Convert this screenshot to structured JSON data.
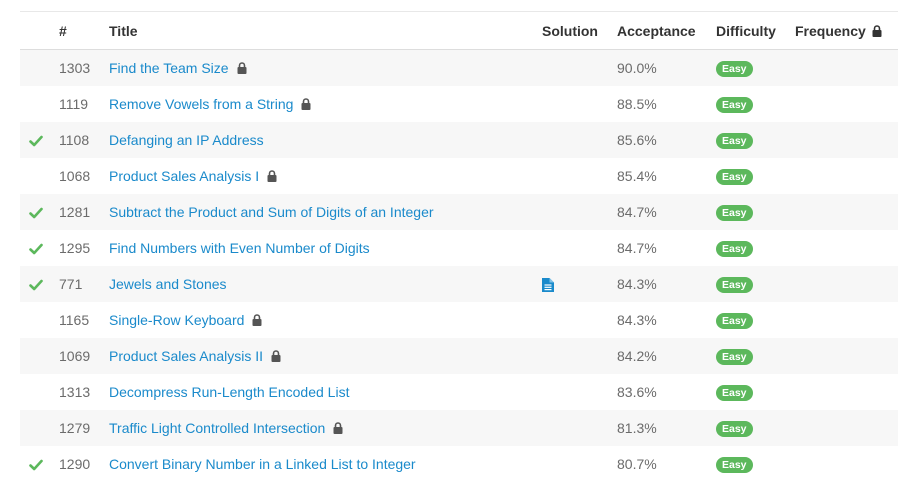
{
  "colors": {
    "link": "#1a8acb",
    "check": "#5cb85c",
    "easy_badge": "#5cb85c",
    "solution_icon": "#1a8acb",
    "lock": "#555555",
    "row_stripe": "#f7f7f7"
  },
  "columns": {
    "id": "#",
    "title": "Title",
    "solution": "Solution",
    "acceptance": "Acceptance",
    "difficulty": "Difficulty",
    "frequency": "Frequency"
  },
  "frequency_locked": true,
  "problems": [
    {
      "solved": false,
      "id": "1303",
      "title": "Find the Team Size",
      "locked": true,
      "solution": false,
      "acceptance": "90.0%",
      "difficulty": "Easy"
    },
    {
      "solved": false,
      "id": "1119",
      "title": "Remove Vowels from a String",
      "locked": true,
      "solution": false,
      "acceptance": "88.5%",
      "difficulty": "Easy"
    },
    {
      "solved": true,
      "id": "1108",
      "title": "Defanging an IP Address",
      "locked": false,
      "solution": false,
      "acceptance": "85.6%",
      "difficulty": "Easy"
    },
    {
      "solved": false,
      "id": "1068",
      "title": "Product Sales Analysis I",
      "locked": true,
      "solution": false,
      "acceptance": "85.4%",
      "difficulty": "Easy"
    },
    {
      "solved": true,
      "id": "1281",
      "title": "Subtract the Product and Sum of Digits of an Integer",
      "locked": false,
      "solution": false,
      "acceptance": "84.7%",
      "difficulty": "Easy"
    },
    {
      "solved": true,
      "id": "1295",
      "title": "Find Numbers with Even Number of Digits",
      "locked": false,
      "solution": false,
      "acceptance": "84.7%",
      "difficulty": "Easy"
    },
    {
      "solved": true,
      "id": "771",
      "title": "Jewels and Stones",
      "locked": false,
      "solution": true,
      "acceptance": "84.3%",
      "difficulty": "Easy"
    },
    {
      "solved": false,
      "id": "1165",
      "title": "Single-Row Keyboard",
      "locked": true,
      "solution": false,
      "acceptance": "84.3%",
      "difficulty": "Easy"
    },
    {
      "solved": false,
      "id": "1069",
      "title": "Product Sales Analysis II",
      "locked": true,
      "solution": false,
      "acceptance": "84.2%",
      "difficulty": "Easy"
    },
    {
      "solved": false,
      "id": "1313",
      "title": "Decompress Run-Length Encoded List",
      "locked": false,
      "solution": false,
      "acceptance": "83.6%",
      "difficulty": "Easy"
    },
    {
      "solved": false,
      "id": "1279",
      "title": "Traffic Light Controlled Intersection",
      "locked": true,
      "solution": false,
      "acceptance": "81.3%",
      "difficulty": "Easy"
    },
    {
      "solved": true,
      "id": "1290",
      "title": "Convert Binary Number in a Linked List to Integer",
      "locked": false,
      "solution": false,
      "acceptance": "80.7%",
      "difficulty": "Easy"
    }
  ]
}
